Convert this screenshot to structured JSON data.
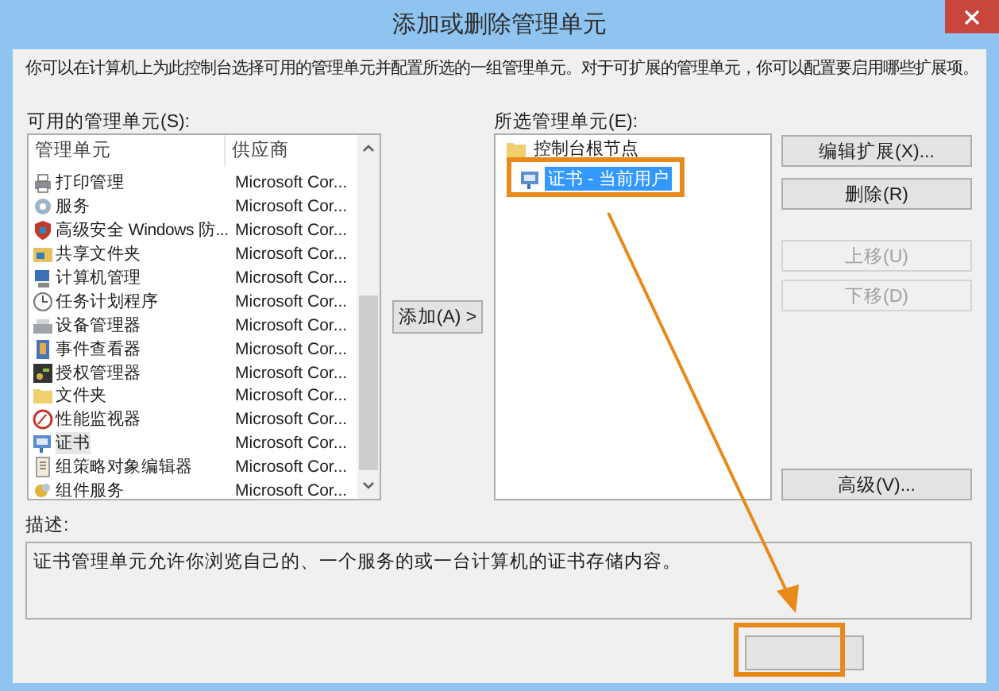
{
  "window": {
    "title": "添加或删除管理单元"
  },
  "intro": "你可以在计算机上为此控制台选择可用的管理单元并配置所选的一组管理单元。对于可扩展的管理单元，你可以配置要启用哪些扩展项。",
  "available": {
    "label": "可用的管理单元(S):",
    "columns": [
      "管理单元",
      "供应商"
    ],
    "rows": [
      {
        "name": "打印管理",
        "vendor": "Microsoft Cor...",
        "selected": false
      },
      {
        "name": "服务",
        "vendor": "Microsoft Cor...",
        "selected": false
      },
      {
        "name": "高级安全 Windows 防...",
        "vendor": "Microsoft Cor...",
        "selected": false
      },
      {
        "name": "共享文件夹",
        "vendor": "Microsoft Cor...",
        "selected": false
      },
      {
        "name": "计算机管理",
        "vendor": "Microsoft Cor...",
        "selected": false
      },
      {
        "name": "任务计划程序",
        "vendor": "Microsoft Cor...",
        "selected": false
      },
      {
        "name": "设备管理器",
        "vendor": "Microsoft Cor...",
        "selected": false
      },
      {
        "name": "事件查看器",
        "vendor": "Microsoft Cor...",
        "selected": false
      },
      {
        "name": "授权管理器",
        "vendor": "Microsoft Cor...",
        "selected": false
      },
      {
        "name": "文件夹",
        "vendor": "Microsoft Cor...",
        "selected": false
      },
      {
        "name": "性能监视器",
        "vendor": "Microsoft Cor...",
        "selected": false
      },
      {
        "name": "证书",
        "vendor": "Microsoft Cor...",
        "selected": true
      },
      {
        "name": "组策略对象编辑器",
        "vendor": "Microsoft Cor...",
        "selected": false
      },
      {
        "name": "组件服务",
        "vendor": "Microsoft Cor...",
        "selected": false
      }
    ]
  },
  "add_button": "添加(A) >",
  "selected_snapins": {
    "label": "所选管理单元(E):",
    "tree": [
      {
        "label": "控制台根节点",
        "selected": false,
        "children": [
          {
            "label": "证书 - 当前用户",
            "selected": true
          }
        ]
      }
    ]
  },
  "side_buttons": [
    {
      "label": "编辑扩展(X)...",
      "disabled": false
    },
    {
      "label": "删除(R)",
      "disabled": false
    },
    {
      "label": "上移(U)",
      "disabled": true
    },
    {
      "label": "下移(D)",
      "disabled": true
    },
    {
      "label": "高级(V)...",
      "disabled": false
    }
  ],
  "description": {
    "label": "描述:",
    "text": "证书管理单元允许你浏览自己的、一个服务的或一台计算机的证书存储内容。"
  }
}
